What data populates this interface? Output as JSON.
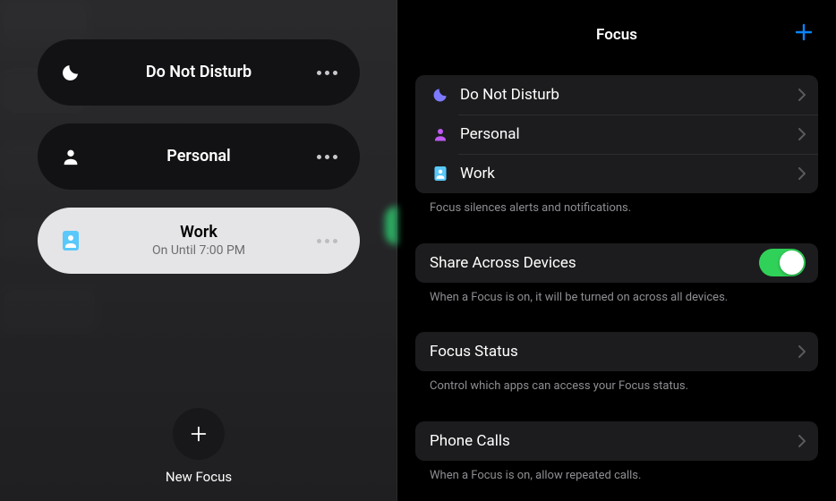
{
  "header": {
    "title": "Focus"
  },
  "left": {
    "cards": [
      {
        "icon": "moon",
        "title": "Do Not Disturb",
        "subtitle": "",
        "active": false
      },
      {
        "icon": "person",
        "title": "Personal",
        "subtitle": "",
        "active": false
      },
      {
        "icon": "badge",
        "title": "Work",
        "subtitle": "On Until 7:00 PM",
        "active": true
      }
    ],
    "new_label": "New Focus"
  },
  "right": {
    "modes": [
      {
        "icon": "moon",
        "color": "#7d7aff",
        "label": "Do Not Disturb"
      },
      {
        "icon": "person",
        "color": "#bf5af2",
        "label": "Personal"
      },
      {
        "icon": "badge",
        "color": "#5ac8fa",
        "label": "Work"
      }
    ],
    "modes_footer": "Focus silences alerts and notifications.",
    "share": {
      "label": "Share Across Devices",
      "on": true,
      "footer": "When a Focus is on, it will be turned on across all devices."
    },
    "status": {
      "label": "Focus Status",
      "footer": "Control which apps can access your Focus status."
    },
    "phone": {
      "label": "Phone Calls",
      "footer": "When a Focus is on, allow repeated calls."
    }
  }
}
